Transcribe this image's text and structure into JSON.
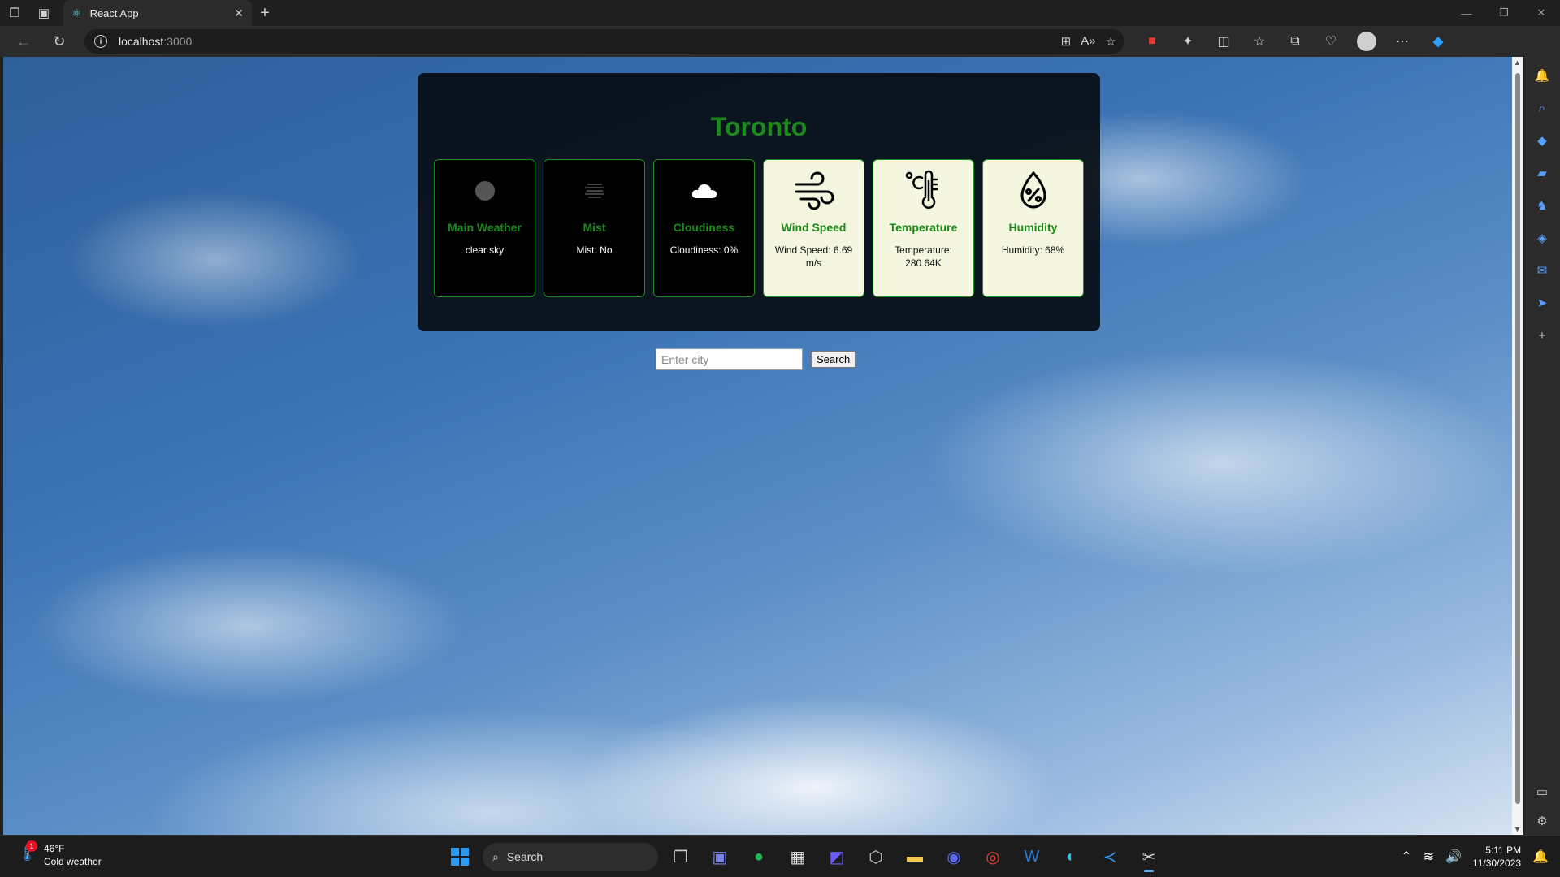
{
  "browser": {
    "tab_title": "React App",
    "url_host": "localhost",
    "url_port": ":3000"
  },
  "weather": {
    "city": "Toronto",
    "search_placeholder": "Enter city",
    "search_label": "Search",
    "cards": [
      {
        "title": "Main Weather",
        "value": "clear sky",
        "style": "dark",
        "icon": "moon-circle-icon"
      },
      {
        "title": "Mist",
        "value": "Mist: No",
        "style": "dark",
        "icon": "mist-icon"
      },
      {
        "title": "Cloudiness",
        "value": "Cloudiness: 0%",
        "style": "dark",
        "icon": "cloud-icon"
      },
      {
        "title": "Wind Speed",
        "value": "Wind Speed: 6.69 m/s",
        "style": "light",
        "icon": "wind-icon"
      },
      {
        "title": "Temperature",
        "value": "Temperature: 280.64K",
        "style": "light",
        "icon": "thermometer-icon"
      },
      {
        "title": "Humidity",
        "value": "Humidity: 68%",
        "style": "light",
        "icon": "humidity-drop-icon"
      }
    ]
  },
  "taskbar": {
    "weather_temp": "46°F",
    "weather_desc": "Cold weather",
    "weather_badge": "1",
    "search_label": "Search",
    "time": "5:11 PM",
    "date": "11/30/2023"
  },
  "colors": {
    "accent_green": "#1a8a1a",
    "panel_bg": "#080e14",
    "light_card_bg": "#f4f6df"
  }
}
